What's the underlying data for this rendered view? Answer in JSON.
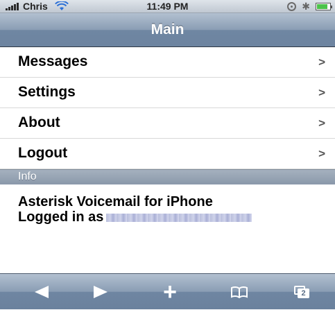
{
  "status_bar": {
    "carrier": "Chris",
    "time": "11:49 PM"
  },
  "nav": {
    "title": "Main"
  },
  "menu": {
    "items": [
      {
        "label": "Messages"
      },
      {
        "label": "Settings"
      },
      {
        "label": "About"
      },
      {
        "label": "Logout"
      }
    ],
    "chevron": ">"
  },
  "section": {
    "label": "Info"
  },
  "info": {
    "line1": "Asterisk Voicemail for iPhone",
    "line2": "Logged in as"
  },
  "toolbar": {
    "pages_count": "2",
    "icons": [
      "back-icon",
      "forward-icon",
      "add-bookmark-icon",
      "bookmarks-icon",
      "pages-icon"
    ]
  }
}
